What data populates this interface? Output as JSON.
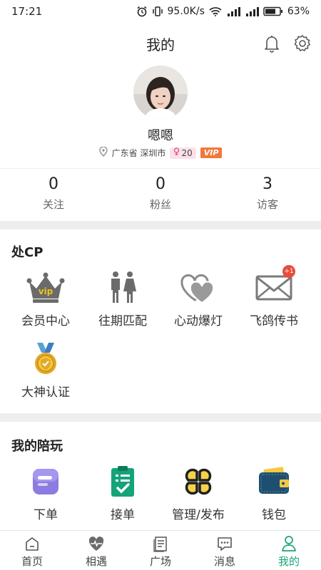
{
  "status_bar": {
    "time": "17:21",
    "network_speed": "95.0K/s",
    "battery": "63%"
  },
  "header": {
    "title": "我的"
  },
  "profile": {
    "nickname": "嗯嗯",
    "location": "广东省 深圳市",
    "age": "20",
    "vip_label": "VIP"
  },
  "stats": [
    {
      "value": "0",
      "label": "关注"
    },
    {
      "value": "0",
      "label": "粉丝"
    },
    {
      "value": "3",
      "label": "访客"
    }
  ],
  "section_cp": {
    "title": "处CP",
    "items": [
      {
        "label": "会员中心",
        "icon": "crown-vip-icon"
      },
      {
        "label": "往期匹配",
        "icon": "couple-icon"
      },
      {
        "label": "心动爆灯",
        "icon": "hearts-icon"
      },
      {
        "label": "飞鸽传书",
        "icon": "envelope-icon",
        "badge": "+1"
      },
      {
        "label": "大神认证",
        "icon": "medal-icon"
      }
    ]
  },
  "section_play": {
    "title": "我的陪玩",
    "items": [
      {
        "label": "下单",
        "icon": "order-icon"
      },
      {
        "label": "接单",
        "icon": "clipboard-check-icon"
      },
      {
        "label": "管理/发布",
        "icon": "clover-grid-icon"
      },
      {
        "label": "钱包",
        "icon": "wallet-icon"
      }
    ]
  },
  "tabbar": {
    "items": [
      {
        "label": "首页",
        "icon": "home-icon"
      },
      {
        "label": "相遇",
        "icon": "heartbeat-icon"
      },
      {
        "label": "广场",
        "icon": "square-doc-icon"
      },
      {
        "label": "消息",
        "icon": "chat-icon"
      },
      {
        "label": "我的",
        "icon": "person-icon",
        "active": true
      }
    ]
  },
  "colors": {
    "accent": "#1aa37a",
    "vip": "#f0783c",
    "badge_red": "#e74c3c",
    "section_gap": "#eeeeee"
  }
}
